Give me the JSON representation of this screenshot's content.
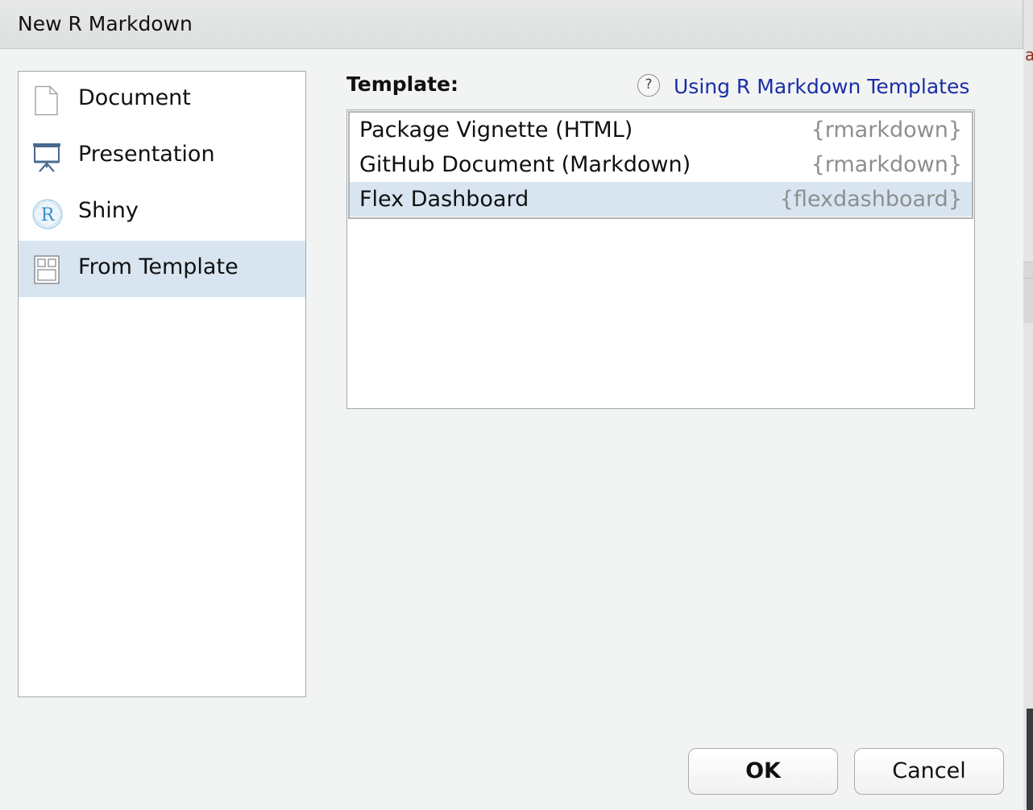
{
  "window": {
    "title": "New R Markdown"
  },
  "edge": {
    "letter": "a"
  },
  "sidebar": {
    "items": [
      {
        "label": "Document",
        "icon": "document-icon",
        "selected": false
      },
      {
        "label": "Presentation",
        "icon": "presentation-icon",
        "selected": false
      },
      {
        "label": "Shiny",
        "icon": "shiny-r-icon",
        "selected": false
      },
      {
        "label": "From Template",
        "icon": "template-icon",
        "selected": true
      }
    ]
  },
  "shiny_icon_letter": "R",
  "template": {
    "heading": "Template:",
    "help_glyph": "?",
    "help_link": "Using R Markdown Templates",
    "rows": [
      {
        "name": "Package Vignette (HTML)",
        "package": "{rmarkdown}",
        "selected": false
      },
      {
        "name": "GitHub Document (Markdown)",
        "package": "{rmarkdown}",
        "selected": false
      },
      {
        "name": "Flex Dashboard",
        "package": "{flexdashboard}",
        "selected": true
      }
    ]
  },
  "buttons": {
    "ok": "OK",
    "cancel": "Cancel"
  },
  "colors": {
    "selection": "#d8e5f1",
    "link": "#1a2ea8",
    "package_text": "#8e8e8e",
    "presentation_icon": "#4a6a8f",
    "shiny_icon": "#3a8fc8"
  }
}
